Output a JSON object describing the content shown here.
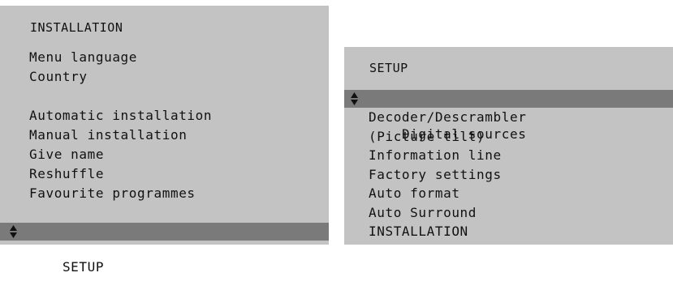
{
  "installation_menu": {
    "title": "INSTALLATION",
    "items": [
      {
        "label": "Menu language"
      },
      {
        "label": "Country"
      },
      {
        "label": "Automatic installation"
      },
      {
        "label": "Manual installation"
      },
      {
        "label": "Give name"
      },
      {
        "label": "Reshuffle"
      },
      {
        "label": "Favourite programmes"
      },
      {
        "label": "SETUP",
        "selected": true
      }
    ]
  },
  "setup_menu": {
    "title": "SETUP",
    "items": [
      {
        "label": "Digital sources",
        "selected": true
      },
      {
        "label": "Decoder/Descrambler"
      },
      {
        "label": "(Picture tilt)"
      },
      {
        "label": "Information line"
      },
      {
        "label": "Factory settings"
      },
      {
        "label": "Auto format"
      },
      {
        "label": "Auto Surround"
      },
      {
        "label": "INSTALLATION"
      }
    ]
  },
  "icons": {
    "selection_marker": "up-down-arrows-icon"
  },
  "colors": {
    "panel": "#c3c3c3",
    "highlight": "#7a7a7a",
    "text": "#111111"
  }
}
